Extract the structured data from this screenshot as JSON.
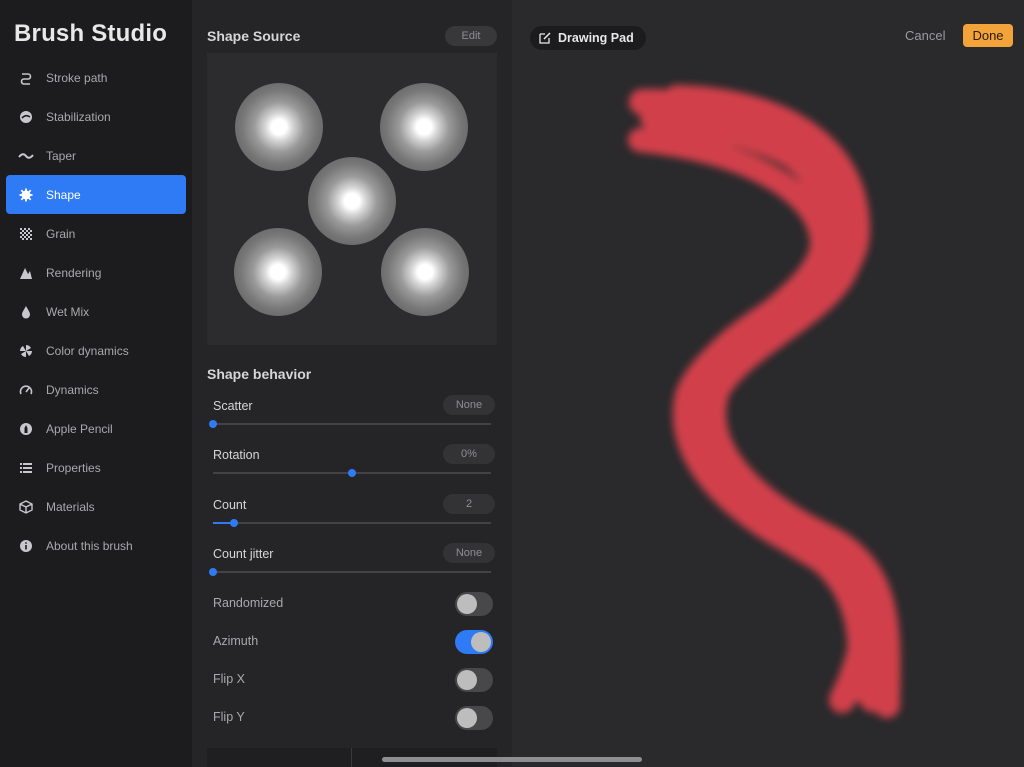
{
  "app": {
    "title": "Brush Studio"
  },
  "sidebar": {
    "items": [
      {
        "label": "Stroke path",
        "icon": "stroke-path-icon",
        "active": false
      },
      {
        "label": "Stabilization",
        "icon": "stabilization-icon",
        "active": false
      },
      {
        "label": "Taper",
        "icon": "taper-icon",
        "active": false
      },
      {
        "label": "Shape",
        "icon": "shape-icon",
        "active": true
      },
      {
        "label": "Grain",
        "icon": "grain-icon",
        "active": false
      },
      {
        "label": "Rendering",
        "icon": "rendering-icon",
        "active": false
      },
      {
        "label": "Wet Mix",
        "icon": "droplet-icon",
        "active": false
      },
      {
        "label": "Color dynamics",
        "icon": "color-dynamics-icon",
        "active": false
      },
      {
        "label": "Dynamics",
        "icon": "gauge-icon",
        "active": false
      },
      {
        "label": "Apple Pencil",
        "icon": "pencil-icon",
        "active": false
      },
      {
        "label": "Properties",
        "icon": "list-icon",
        "active": false
      },
      {
        "label": "Materials",
        "icon": "cube-icon",
        "active": false
      },
      {
        "label": "About this brush",
        "icon": "info-icon",
        "active": false
      }
    ]
  },
  "shape_source": {
    "title": "Shape Source",
    "edit_label": "Edit"
  },
  "shape_behavior": {
    "title": "Shape behavior",
    "sliders": [
      {
        "label": "Scatter",
        "value": "None",
        "fraction": 0.0
      },
      {
        "label": "Rotation",
        "value": "0%",
        "fraction": 0.5
      },
      {
        "label": "Count",
        "value": "2",
        "fraction": 0.076
      },
      {
        "label": "Count jitter",
        "value": "None",
        "fraction": 0.0
      }
    ],
    "toggles": [
      {
        "label": "Randomized",
        "on": false
      },
      {
        "label": "Azimuth",
        "on": true
      },
      {
        "label": "Flip X",
        "on": false
      },
      {
        "label": "Flip Y",
        "on": false
      }
    ]
  },
  "drawing_pad": {
    "title": "Drawing Pad",
    "cancel_label": "Cancel",
    "done_label": "Done",
    "stroke_color": "#e0424d"
  },
  "colors": {
    "accent": "#2f7bf6",
    "done": "#f2a33a"
  }
}
